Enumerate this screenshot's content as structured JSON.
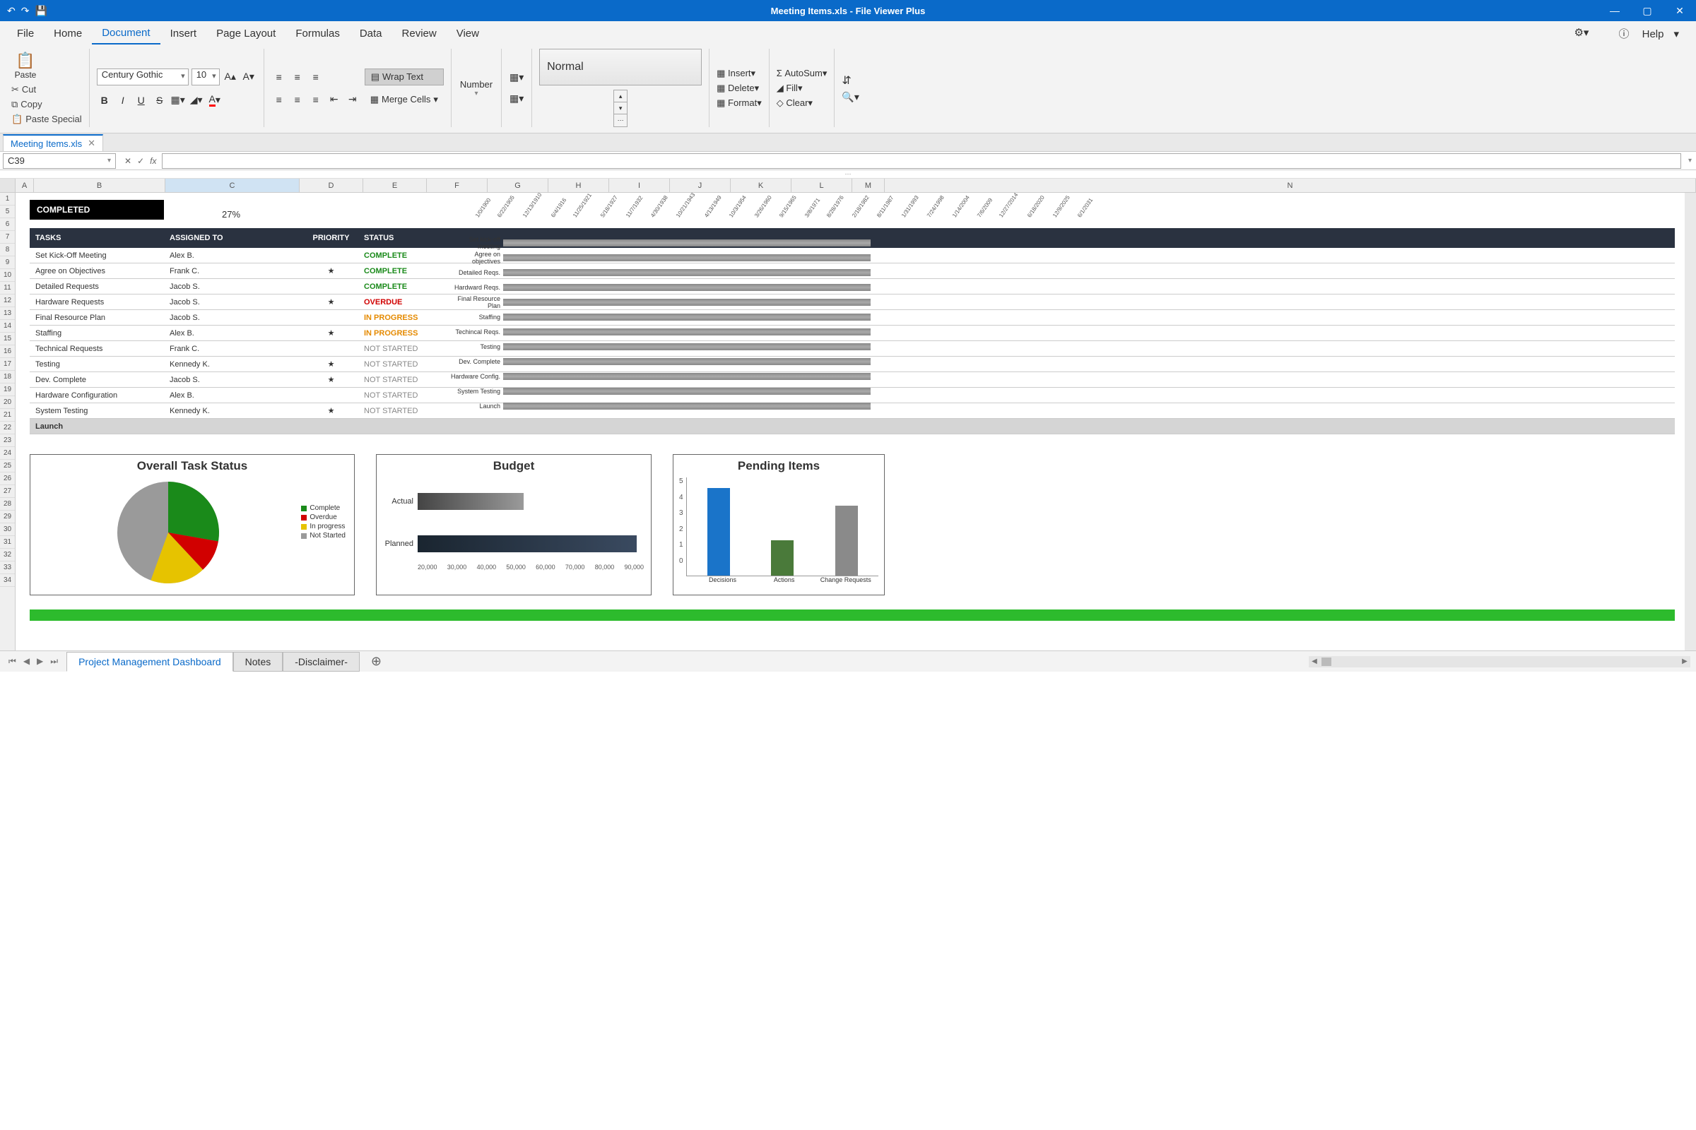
{
  "window": {
    "title": "Meeting Items.xls - File Viewer Plus",
    "doc_tab": "Meeting Items.xls"
  },
  "ribbon": {
    "tabs": [
      "File",
      "Home",
      "Document",
      "Insert",
      "Page Layout",
      "Formulas",
      "Data",
      "Review",
      "View"
    ],
    "active_tab": "Document",
    "help": "Help",
    "cut": "Cut",
    "copy": "Copy",
    "paste": "Paste",
    "paste_special": "Paste Special",
    "font_name": "Century Gothic",
    "font_size": "10",
    "wrap_text": "Wrap Text",
    "merge_cells": "Merge Cells",
    "number": "Number",
    "style_normal": "Normal",
    "insert": "Insert",
    "delete": "Delete",
    "format": "Format",
    "autosum": "AutoSum",
    "fill": "Fill",
    "clear": "Clear"
  },
  "formula": {
    "cell_ref": "C39"
  },
  "columns": [
    "A",
    "B",
    "C",
    "D",
    "E",
    "F",
    "G",
    "H",
    "I",
    "J",
    "K",
    "L",
    "M",
    "N"
  ],
  "row_numbers": [
    "1",
    "5",
    "6",
    "7",
    "8",
    "9",
    "10",
    "11",
    "12",
    "13",
    "14",
    "15",
    "16",
    "17",
    "18",
    "19",
    "20",
    "21",
    "22",
    "23",
    "24",
    "25",
    "26",
    "27",
    "28",
    "29",
    "30",
    "31",
    "32",
    "33",
    "34"
  ],
  "completed": {
    "label": "COMPLETED",
    "pct": "27%"
  },
  "table": {
    "headers": {
      "tasks": "TASKS",
      "assigned": "ASSIGNED TO",
      "priority": "PRIORITY",
      "status": "STATUS"
    },
    "rows": [
      {
        "task": "Set Kick-Off Meeting",
        "assigned": "Alex B.",
        "pri": "",
        "status": "COMPLETE"
      },
      {
        "task": "Agree on Objectives",
        "assigned": "Frank C.",
        "pri": "★",
        "status": "COMPLETE"
      },
      {
        "task": "Detailed Requests",
        "assigned": "Jacob S.",
        "pri": "",
        "status": "COMPLETE"
      },
      {
        "task": "Hardware Requests",
        "assigned": "Jacob S.",
        "pri": "★",
        "status": "OVERDUE"
      },
      {
        "task": "Final Resource Plan",
        "assigned": "Jacob S.",
        "pri": "",
        "status": "IN PROGRESS"
      },
      {
        "task": "Staffing",
        "assigned": "Alex B.",
        "pri": "★",
        "status": "IN PROGRESS"
      },
      {
        "task": "Technical Requests",
        "assigned": "Frank C.",
        "pri": "",
        "status": "NOT STARTED"
      },
      {
        "task": "Testing",
        "assigned": "Kennedy K.",
        "pri": "★",
        "status": "NOT STARTED"
      },
      {
        "task": "Dev. Complete",
        "assigned": "Jacob S.",
        "pri": "★",
        "status": "NOT STARTED"
      },
      {
        "task": "Hardware Configuration",
        "assigned": "Alex B.",
        "pri": "",
        "status": "NOT STARTED"
      },
      {
        "task": "System Testing",
        "assigned": "Kennedy K.",
        "pri": "★",
        "status": "NOT STARTED"
      },
      {
        "task": "Launch",
        "assigned": "",
        "pri": "",
        "status": ""
      }
    ]
  },
  "gantt": {
    "dates": [
      "1/0/1900",
      "6/22/1905",
      "12/13/1910",
      "6/4/1916",
      "11/25/1921",
      "5/18/1927",
      "11/7/1932",
      "4/30/1938",
      "10/21/1943",
      "4/13/1949",
      "10/3/1954",
      "3/26/1960",
      "9/15/1965",
      "3/8/1971",
      "8/28/1976",
      "2/18/1982",
      "8/11/1987",
      "1/31/1993",
      "7/24/1998",
      "1/14/2004",
      "7/6/2009",
      "12/27/2014",
      "6/18/2020",
      "12/9/2025",
      "6/1/2031"
    ],
    "rows": [
      "Set kick-off meeting",
      "Agree on objectives",
      "Detailed Reqs.",
      "Hardward Reqs.",
      "Final Resource Plan",
      "Staffing",
      "Techincal Reqs.",
      "Testing",
      "Dev. Complete",
      "Hardware Config.",
      "System Testing",
      "Launch"
    ]
  },
  "charts": {
    "overall_title": "Overall Task Status",
    "budget_title": "Budget",
    "pending_title": "Pending Items",
    "legend": {
      "complete": "Complete",
      "overdue": "Overdue",
      "inprogress": "In progress",
      "notstarted": "Not Started"
    },
    "budget_rows": {
      "actual": "Actual",
      "planned": "Planned"
    },
    "pending_cats": {
      "decisions": "Decisions",
      "actions": "Actions",
      "changes": "Change Requests"
    }
  },
  "chart_data": [
    {
      "type": "pie",
      "title": "Overall Task Status",
      "series": [
        {
          "name": "Complete",
          "value": 27,
          "color": "#1a8a1a"
        },
        {
          "name": "Overdue",
          "value": 9,
          "color": "#d10000"
        },
        {
          "name": "In progress",
          "value": 18,
          "color": "#e6c300"
        },
        {
          "name": "Not Started",
          "value": 46,
          "color": "#9a9a9a"
        }
      ]
    },
    {
      "type": "bar",
      "title": "Budget",
      "orientation": "horizontal",
      "categories": [
        "Actual",
        "Planned"
      ],
      "values": [
        52000,
        88000
      ],
      "xlim": [
        20000,
        90000
      ],
      "xticks": [
        20000,
        30000,
        40000,
        50000,
        60000,
        70000,
        80000,
        90000
      ],
      "colors": [
        "#7a7a7a",
        "#2a3240"
      ]
    },
    {
      "type": "bar",
      "title": "Pending Items",
      "categories": [
        "Decisions",
        "Actions",
        "Change Requests"
      ],
      "values": [
        5,
        2,
        4
      ],
      "ylim": [
        0,
        5
      ],
      "yticks": [
        0,
        1,
        2,
        3,
        4,
        5
      ],
      "colors": [
        "#1a74c9",
        "#4a7a3a",
        "#8a8a8a"
      ]
    }
  ],
  "sheets": {
    "tabs": [
      "Project Management Dashboard",
      "Notes",
      "-Disclaimer-"
    ],
    "active": "Project Management Dashboard"
  }
}
